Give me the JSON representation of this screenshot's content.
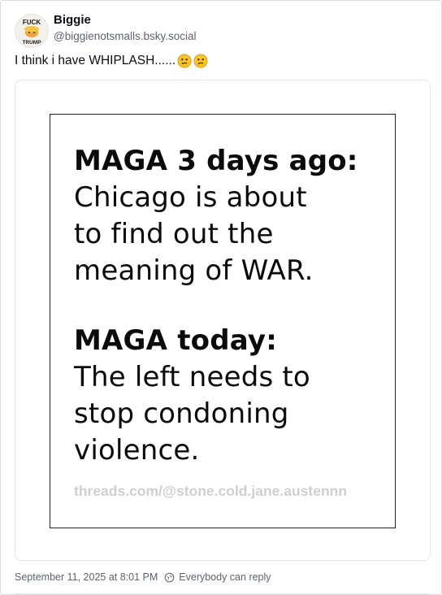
{
  "post": {
    "author_name": "Biggie",
    "author_handle": "@biggienotsmalls.bsky.social",
    "avatar": {
      "line1": "FUCK",
      "line2": "TRUMP"
    },
    "text": "I think i have WHIPLASH......",
    "emojis": [
      "confused-face-emoji",
      "confused-face-emoji"
    ],
    "image": {
      "block1": {
        "line1": "MAGA 3 days ago:",
        "line2": "Chicago is about",
        "line3": "to find out the",
        "line4": "meaning of WAR."
      },
      "block2": {
        "line1": "MAGA today:",
        "line2": "The left needs to",
        "line3": "stop condoning",
        "line4": "violence."
      },
      "watermark": "threads.com/@stone.cold.jane.austennn"
    },
    "timestamp": "September 11, 2025 at 8:01 PM",
    "reply_setting": "Everybody can reply"
  }
}
